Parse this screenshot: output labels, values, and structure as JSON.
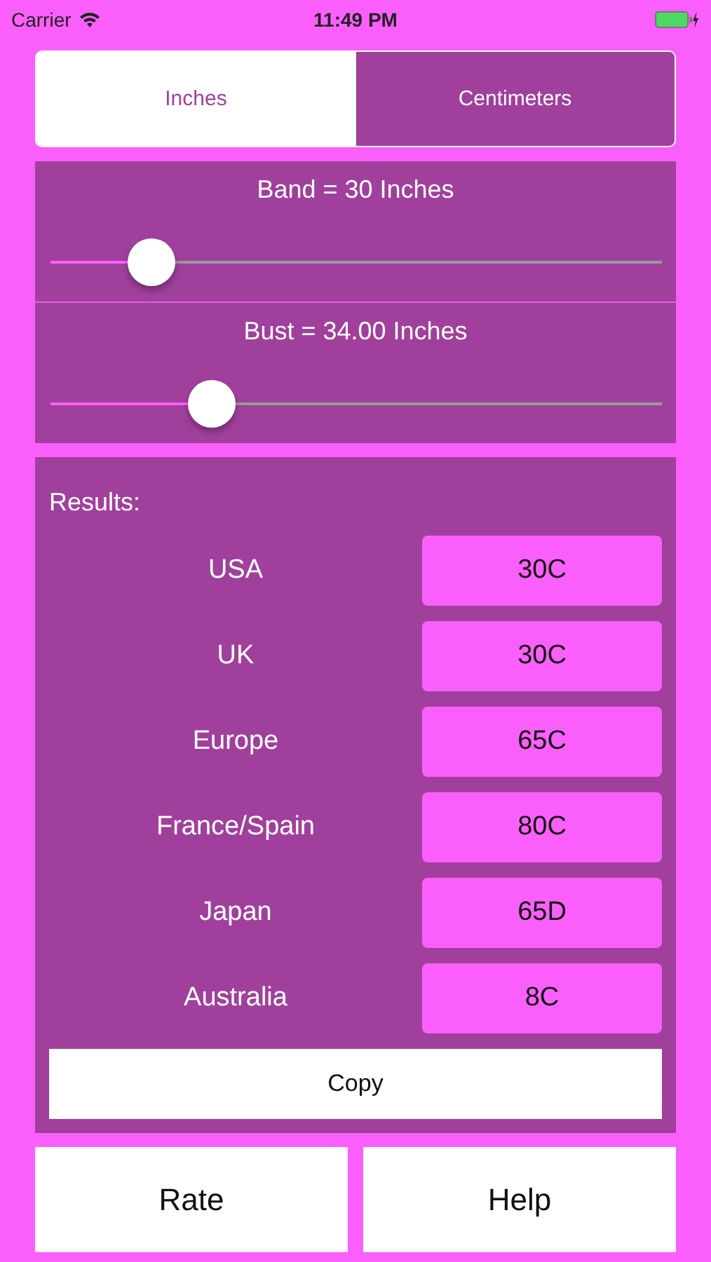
{
  "status_bar": {
    "carrier": "Carrier",
    "time": "11:49 PM"
  },
  "units": [
    {
      "label": "Inches",
      "selected": true
    },
    {
      "label": "Centimeters",
      "selected": false
    }
  ],
  "sliders": [
    {
      "label": "Band = 30 Inches",
      "level": 0.167
    },
    {
      "label": "Bust = 34.00 Inches",
      "level": 0.266
    }
  ],
  "results": {
    "title": "Results:",
    "rows": [
      {
        "region": "USA",
        "size": "30C"
      },
      {
        "region": "UK",
        "size": "30C"
      },
      {
        "region": "Europe",
        "size": "65C"
      },
      {
        "region": "France/Spain",
        "size": "80C"
      },
      {
        "region": "Japan",
        "size": "65D"
      },
      {
        "region": "Australia",
        "size": "8C"
      }
    ],
    "copy_button": "Copy"
  },
  "buttons": [
    "Rate",
    "Help"
  ]
}
